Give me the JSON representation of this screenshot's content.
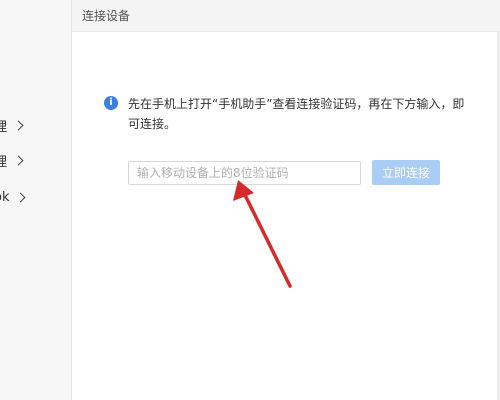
{
  "sidebar": {
    "items": [
      {
        "label": "理"
      },
      {
        "label": "理"
      },
      {
        "label": "ok"
      }
    ]
  },
  "panel": {
    "title": "连接设备"
  },
  "info": {
    "icon": "info-icon",
    "message": "先在手机上打开“手机助手”查看连接验证码，再在下方输入，即可连接。"
  },
  "connect_form": {
    "input_placeholder": "输入移动设备上的8位验证码",
    "input_value": "",
    "button_label": "立即连接"
  },
  "colors": {
    "accent": "#3b7fe0",
    "button_disabled": "#a9cdf4",
    "annotation_arrow": "#d42a2a"
  }
}
